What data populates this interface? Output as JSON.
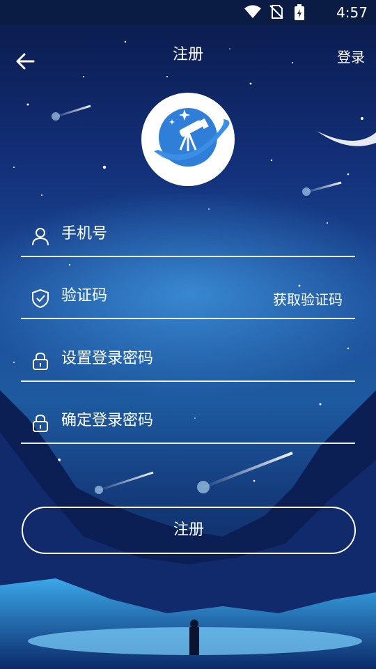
{
  "status_bar": {
    "time": "4:57",
    "icons": [
      "wifi-icon",
      "no-sim-icon",
      "battery-charging-icon"
    ]
  },
  "nav": {
    "title": "注册",
    "back_icon": "back-arrow-icon",
    "login_label": "登录"
  },
  "logo": {
    "icon": "telescope-planet-icon",
    "colors": {
      "background": "#ffffff",
      "primary": "#2f7fd8",
      "ring": "#3a8ee6"
    }
  },
  "form": {
    "phone": {
      "placeholder": "手机号",
      "icon": "user-icon"
    },
    "code": {
      "placeholder": "验证码",
      "icon": "shield-check-icon",
      "get_code_label": "获取验证码"
    },
    "password": {
      "placeholder": "设置登录密码",
      "icon": "lock-icon"
    },
    "confirm_password": {
      "placeholder": "确定登录密码",
      "icon": "lock-icon"
    }
  },
  "register_button": {
    "label": "注册"
  },
  "colors": {
    "background_top": "#0a1a4a",
    "background_mid": "#1e5aa0",
    "text": "#ffffff",
    "underline": "#e8eef8"
  }
}
